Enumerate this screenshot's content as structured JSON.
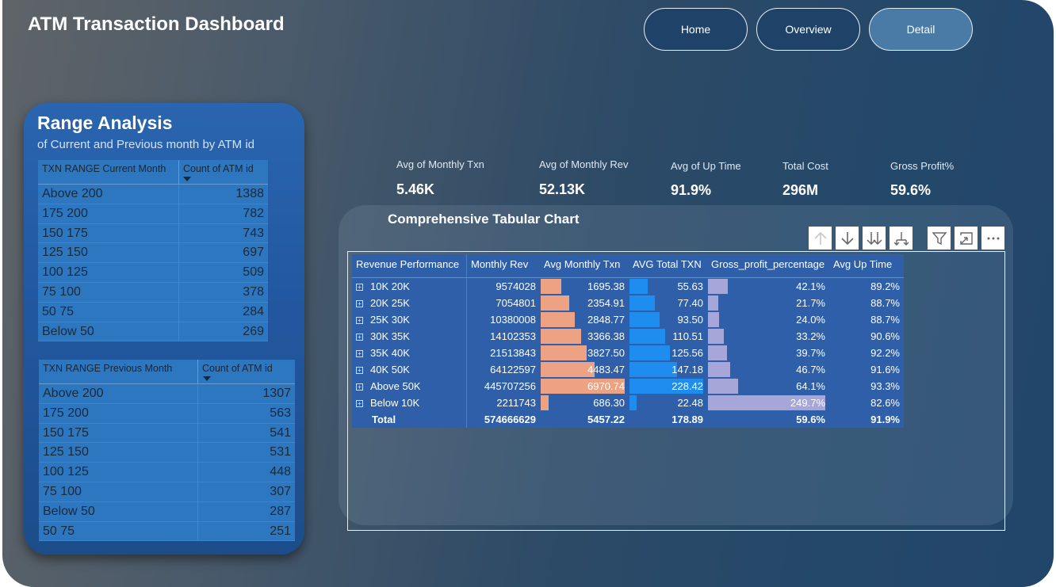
{
  "page": {
    "title": "ATM Transaction Dashboard"
  },
  "nav": {
    "home": "Home",
    "overview": "Overview",
    "detail": "Detail"
  },
  "range": {
    "title": "Range Analysis",
    "subtitle": "of Current and Previous month by ATM id",
    "current": {
      "col1": "TXN RANGE Current Month",
      "col2": "Count of ATM id",
      "rows": [
        [
          "Above 200",
          "1388"
        ],
        [
          "175 200",
          "782"
        ],
        [
          "150 175",
          "743"
        ],
        [
          "125 150",
          "697"
        ],
        [
          "100 125",
          "509"
        ],
        [
          "75 100",
          "378"
        ],
        [
          "50 75",
          "284"
        ],
        [
          "Below 50",
          "269"
        ]
      ]
    },
    "previous": {
      "col1": "TXN RANGE Previous Month",
      "col2": "Count of ATM id",
      "rows": [
        [
          "Above 200",
          "1307"
        ],
        [
          "175 200",
          "563"
        ],
        [
          "150 175",
          "541"
        ],
        [
          "125 150",
          "531"
        ],
        [
          "100 125",
          "448"
        ],
        [
          "75 100",
          "307"
        ],
        [
          "Below 50",
          "287"
        ],
        [
          "50 75",
          "251"
        ]
      ]
    }
  },
  "kpis": [
    {
      "label": "Avg of Monthly Txn",
      "value": "5.46K"
    },
    {
      "label": "Avg of Monthly Rev",
      "value": "52.13K"
    },
    {
      "label": "Avg of Up Time",
      "value": "91.9%"
    },
    {
      "label": "Total Cost",
      "value": "296M"
    },
    {
      "label": "Gross Profit%",
      "value": "59.6%"
    }
  ],
  "tabular": {
    "title": "Comprehensive Tabular Chart",
    "toolbar_icons": [
      "arrow-up-icon",
      "arrow-down-icon",
      "double-arrow-down-icon",
      "expand-hierarchy-icon",
      "filter-icon",
      "focus-mode-icon",
      "more-options-icon"
    ],
    "headers": [
      "Revenue Performance",
      "Monthly Rev",
      "Avg Monthly Txn",
      "AVG Total TXN",
      "Gross_profit_percentage",
      "Avg Up Time"
    ],
    "rows": [
      {
        "name": "10K 20K",
        "rev": "9574028",
        "txn": "1695.38",
        "txn_v": 1695.38,
        "total": "55.63",
        "total_v": 55.63,
        "gp": "42.1%",
        "gp_v": 42.1,
        "up": "89.2%"
      },
      {
        "name": "20K 25K",
        "rev": "7054801",
        "txn": "2354.91",
        "txn_v": 2354.91,
        "total": "77.40",
        "total_v": 77.4,
        "gp": "21.7%",
        "gp_v": 21.7,
        "up": "88.7%"
      },
      {
        "name": "25K 30K",
        "rev": "10380008",
        "txn": "2848.77",
        "txn_v": 2848.77,
        "total": "93.50",
        "total_v": 93.5,
        "gp": "24.0%",
        "gp_v": 24.0,
        "up": "88.7%"
      },
      {
        "name": "30K 35K",
        "rev": "14102353",
        "txn": "3366.38",
        "txn_v": 3366.38,
        "total": "110.51",
        "total_v": 110.51,
        "gp": "33.2%",
        "gp_v": 33.2,
        "up": "90.6%"
      },
      {
        "name": "35K 40K",
        "rev": "21513843",
        "txn": "3827.50",
        "txn_v": 3827.5,
        "total": "125.56",
        "total_v": 125.56,
        "gp": "39.7%",
        "gp_v": 39.7,
        "up": "92.2%"
      },
      {
        "name": "40K 50K",
        "rev": "64122597",
        "txn": "4483.47",
        "txn_v": 4483.47,
        "total": "147.18",
        "total_v": 147.18,
        "gp": "46.7%",
        "gp_v": 46.7,
        "up": "91.6%"
      },
      {
        "name": "Above 50K",
        "rev": "445707256",
        "txn": "6970.74",
        "txn_v": 6970.74,
        "total": "228.42",
        "total_v": 228.42,
        "gp": "64.1%",
        "gp_v": 64.1,
        "up": "93.3%"
      },
      {
        "name": "Below 10K",
        "rev": "2211743",
        "txn": "686.30",
        "txn_v": 686.3,
        "total": "22.48",
        "total_v": 22.48,
        "gp": "249.7%",
        "gp_v": 249.7,
        "up": "82.6%"
      }
    ],
    "total": {
      "name": "Total",
      "rev": "574666629",
      "txn": "5457.22",
      "total": "178.89",
      "gp": "59.6%",
      "up": "91.9%"
    },
    "bar_colors": {
      "txn": "#eda383",
      "total": "#1f8cf0",
      "gp": "#a6a7d8"
    }
  }
}
